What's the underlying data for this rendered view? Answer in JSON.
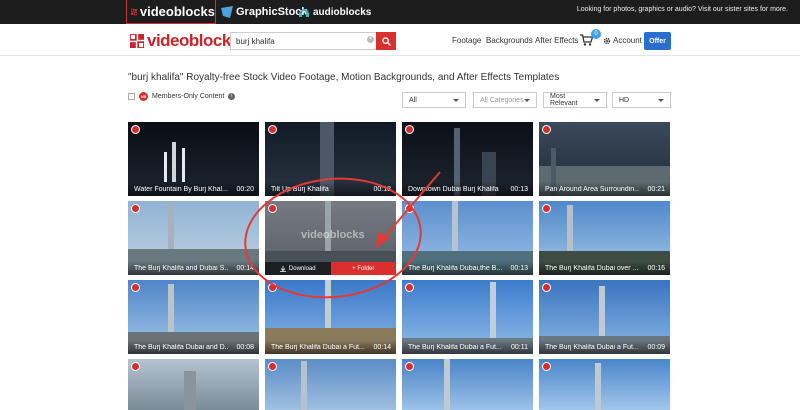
{
  "sister_sites": {
    "videoblocks": "videoblocks",
    "graphicstock": "GraphicStock",
    "audioblocks": "audioblocks",
    "tagline": "Looking for photos, graphics or audio? Visit our sister sites for more."
  },
  "header": {
    "logo": "videoblocks",
    "search_value": "burj khalifa",
    "nav": [
      "Footage",
      "Backgrounds",
      "After Effects"
    ],
    "cart_count": "0",
    "account": "Account",
    "offer": "Offer"
  },
  "page": {
    "title": "\"burj khalifa\" Royalty-free Stock Video Footage, Motion Backgrounds, and After Effects Templates",
    "members_only": "Members-Only Content",
    "filters": [
      "All",
      "All Categories",
      "Most Relevant",
      "HD"
    ]
  },
  "clips": [
    {
      "title": "Water Fountain By Burj Khal...",
      "duration": "00:20"
    },
    {
      "title": "Tilt Up Burj Khalifa",
      "duration": "00:18"
    },
    {
      "title": "Downtown Dubai Burj Khalifa",
      "duration": "00:13"
    },
    {
      "title": "Pan Around Area Surroundin...",
      "duration": "00:21"
    },
    {
      "title": "The Burj Khalifa and Dubai S...",
      "duration": "00:14"
    },
    {
      "title": "",
      "duration": ""
    },
    {
      "title": "The Burj Khalifa Dubai,the B...",
      "duration": "00:13"
    },
    {
      "title": "The Burj Khalifa Dubai over ...",
      "duration": "00:16"
    },
    {
      "title": "The Burj Khalifa Dubai and D...",
      "duration": "00:08"
    },
    {
      "title": "The Burj Khalifa Dubai a Fut...",
      "duration": "00:14"
    },
    {
      "title": "The Burj Khalifa Dubai a Fut...",
      "duration": "00:11"
    },
    {
      "title": "The Burj Khalifa Dubai a Fut...",
      "duration": "00:09"
    }
  ],
  "hover": {
    "watermark": "videoblocks",
    "download": "Download",
    "folder": "+ Folder"
  },
  "colors": {
    "brand_red": "#d32f2f",
    "annotation_red": "#e53935",
    "offer_blue": "#2a6fcf"
  }
}
